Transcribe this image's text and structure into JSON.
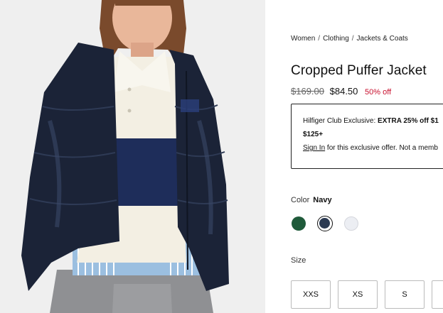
{
  "product_image": {
    "alt": ""
  },
  "breadcrumb": [
    "Women",
    "Clothing",
    "Jackets & Coats"
  ],
  "breadcrumb_separator": "/",
  "product": {
    "title": "Cropped Puffer Jacket",
    "price_original": "$169.00",
    "price_sale": "$84.50",
    "discount": "50% off"
  },
  "promo": {
    "line1_prefix": "Hilfiger Club Exclusive: ",
    "line1_bold": "EXTRA 25% off $1",
    "line2_bold": "$125+",
    "signin_label": "Sign In",
    "line3_rest": " for this exclusive offer. Not a memb"
  },
  "color": {
    "label": "Color",
    "selected": "Navy",
    "swatches": [
      {
        "name": "green-swatch",
        "hex": "#1f5a3a"
      },
      {
        "name": "navy-swatch",
        "hex": "#2b3a52"
      },
      {
        "name": "white-swatch",
        "hex": "#eceef3"
      }
    ]
  },
  "size": {
    "label": "Size",
    "options": [
      "XXS",
      "XS",
      "S",
      ""
    ]
  },
  "colors": {
    "sale_red": "#c8102e",
    "border": "#222222"
  }
}
